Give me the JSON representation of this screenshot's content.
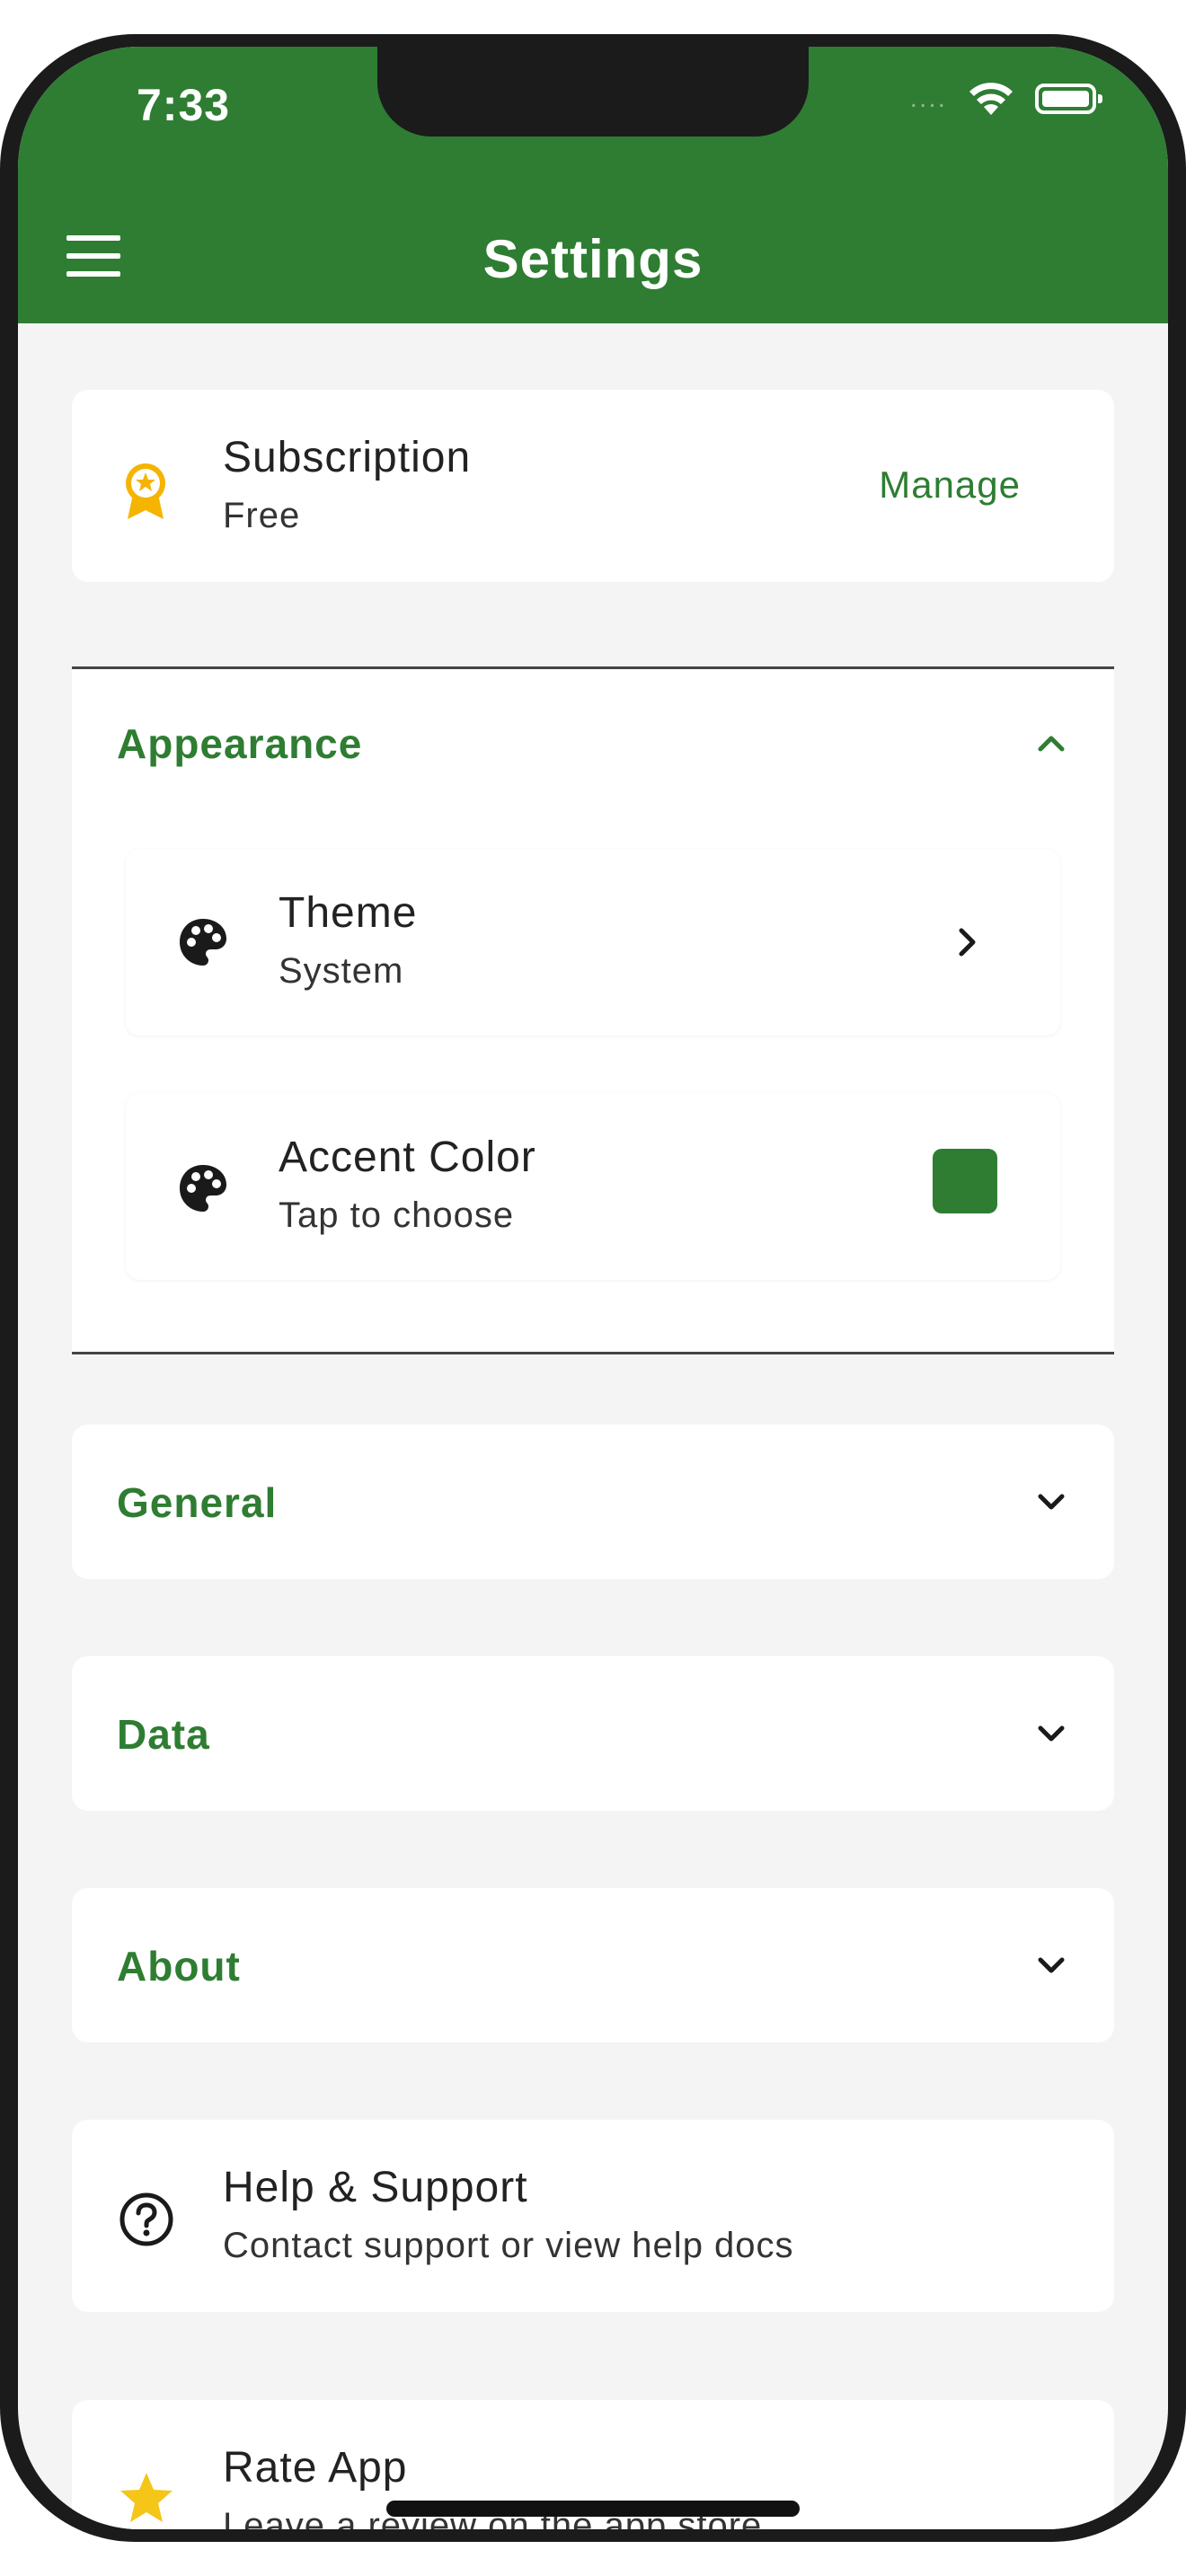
{
  "status_bar": {
    "time": "7:33",
    "signal_dots": "....",
    "icons": [
      "wifi-icon",
      "battery-icon"
    ]
  },
  "app_bar": {
    "title": "Settings",
    "menu_icon": "hamburger-menu-icon"
  },
  "subscription": {
    "icon": "award-badge-icon",
    "title": "Subscription",
    "subtitle": "Free",
    "action_label": "Manage"
  },
  "sections": {
    "appearance": {
      "title": "Appearance",
      "expanded": true,
      "items": [
        {
          "icon": "palette-icon",
          "title": "Theme",
          "subtitle": "System",
          "trailing": "chevron-right-icon"
        },
        {
          "icon": "palette-icon",
          "title": "Accent Color",
          "subtitle": "Tap to choose",
          "trailing": "color-swatch"
        }
      ]
    },
    "general": {
      "title": "General",
      "expanded": false
    },
    "data": {
      "title": "Data",
      "expanded": false
    },
    "about": {
      "title": "About",
      "expanded": false
    }
  },
  "help": {
    "icon": "help-circle-icon",
    "title": "Help & Support",
    "subtitle": "Contact support or view help docs"
  },
  "rate": {
    "icon": "star-icon",
    "title": "Rate App",
    "subtitle": "Leave a review on the app store"
  },
  "colors": {
    "primary": "#2e7d32",
    "accent_swatch": "#2e7d32",
    "background": "#f4f4f4",
    "star": "#f5c518",
    "badge": "#f5b400"
  }
}
